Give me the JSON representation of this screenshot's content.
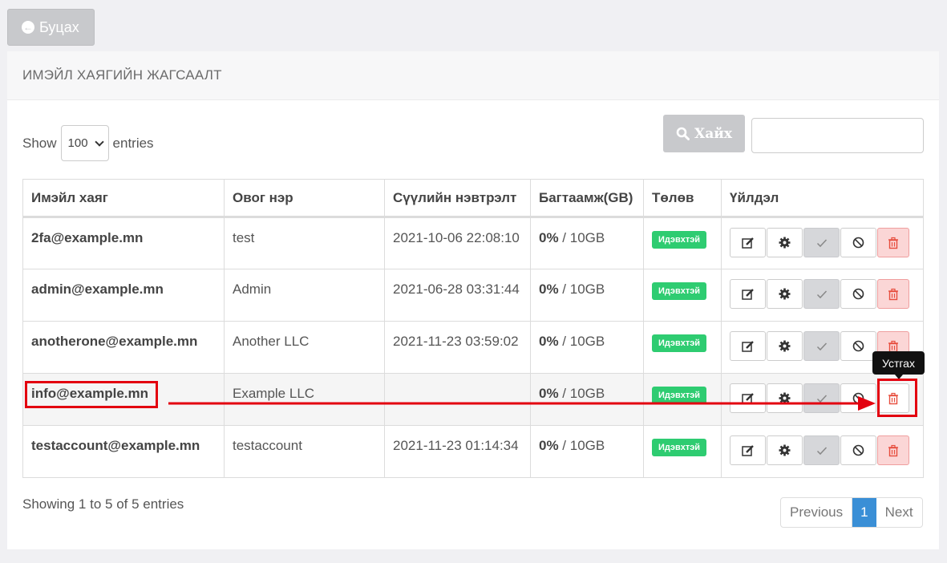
{
  "back_button": {
    "label": "Буцах"
  },
  "panel": {
    "title": "ИМЭЙЛ ХАЯГИЙН ЖАГСААЛТ"
  },
  "length_menu": {
    "prefix": "Show",
    "value": "100",
    "suffix": "entries"
  },
  "search": {
    "button_label": "Хайх",
    "value": ""
  },
  "table": {
    "headers": [
      "Имэйл хаяг",
      "Овог нэр",
      "Сүүлийн нэвтрэлт",
      "Багтаамж(GB)",
      "Төлөв",
      "Үйлдэл"
    ],
    "rows": [
      {
        "email": "2fa@example.mn",
        "name": "test",
        "last_login": "2021-10-06 22:08:10",
        "usage_pct": "0%",
        "quota": " / 10GB",
        "status": "Идэвхтэй"
      },
      {
        "email": "admin@example.mn",
        "name": "Admin",
        "last_login": "2021-06-28 03:31:44",
        "usage_pct": "0%",
        "quota": " / 10GB",
        "status": "Идэвхтэй"
      },
      {
        "email": "anotherone@example.mn",
        "name": "Another LLC",
        "last_login": "2021-11-23 03:59:02",
        "usage_pct": "0%",
        "quota": " / 10GB",
        "status": "Идэвхтэй"
      },
      {
        "email": "info@example.mn",
        "name": "Example LLC",
        "last_login": "",
        "usage_pct": "0%",
        "quota": " / 10GB",
        "status": "Идэвхтэй"
      },
      {
        "email": "testaccount@example.mn",
        "name": "testaccount",
        "last_login": "2021-11-23 01:14:34",
        "usage_pct": "0%",
        "quota": " / 10GB",
        "status": "Идэвхтэй"
      }
    ],
    "action_icons": [
      "edit-icon",
      "gear-icon",
      "check-icon",
      "ban-icon",
      "trash-icon"
    ]
  },
  "tooltip": {
    "label": "Устгах"
  },
  "footer": {
    "info": "Showing 1 to 5 of 5 entries"
  },
  "pagination": {
    "previous": "Previous",
    "current": "1",
    "next": "Next"
  },
  "colors": {
    "badge": "#2ecc71",
    "delete": "#e74c3c",
    "annotation": "#e3000f",
    "page_active": "#3a8fd6"
  }
}
